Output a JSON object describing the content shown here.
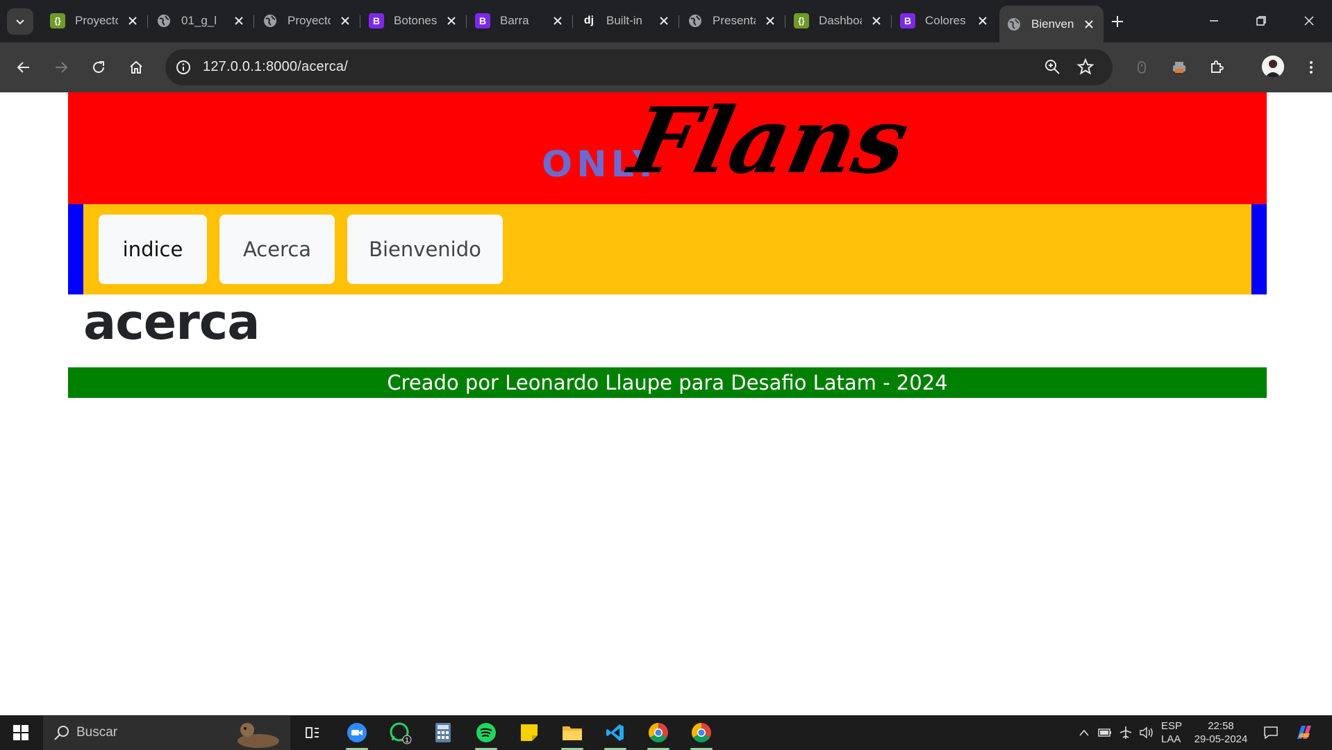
{
  "browser": {
    "tabs": [
      {
        "title": "Proyecto",
        "favicon": "json-icon",
        "active": false
      },
      {
        "title": "01_g_l",
        "favicon": "globe-icon",
        "active": false
      },
      {
        "title": "Proyecto",
        "favicon": "globe-icon",
        "active": false
      },
      {
        "title": "Botones",
        "favicon": "bootstrap-icon",
        "active": false
      },
      {
        "title": "Barra",
        "favicon": "bootstrap-icon",
        "active": false
      },
      {
        "title": "Built-in",
        "favicon": "django-icon",
        "active": false
      },
      {
        "title": "Presentación",
        "favicon": "globe-icon",
        "active": false
      },
      {
        "title": "Dashboard",
        "favicon": "json-icon",
        "active": false
      },
      {
        "title": "Colores",
        "favicon": "bootstrap-icon",
        "active": false
      },
      {
        "title": "Bienvenido",
        "favicon": "globe-icon",
        "active": true
      }
    ],
    "favicon_letters": {
      "bootstrap": "B",
      "django": "dj",
      "json": "{}"
    },
    "url": "127.0.0.1:8000/acerca/"
  },
  "page": {
    "logo_only": "ONLY",
    "logo_flans": "Flans",
    "nav": {
      "indice": "indice",
      "acerca": "Acerca",
      "bienvenido": "Bienvenido"
    },
    "heading": "acerca",
    "footer": "Creado por Leonardo Llaupe para Desafio Latam - 2024",
    "colors": {
      "header": "#ff0000",
      "navbar": "#ffc107",
      "nav_side": "#0000ff",
      "footer": "#008000",
      "logo_only": "#6b6bcf"
    }
  },
  "taskbar": {
    "search_placeholder": "Buscar",
    "apps": [
      "task-view-icon",
      "zoom-icon",
      "whatsapp-icon",
      "calculator-icon",
      "spotify-icon",
      "sticky-notes-icon",
      "file-explorer-icon",
      "vscode-icon",
      "chrome-icon",
      "chrome-icon"
    ],
    "whatsapp_badge": "1",
    "language": "ESP",
    "keyboard": "LAA",
    "time": "22:58",
    "date": "29-05-2024"
  }
}
